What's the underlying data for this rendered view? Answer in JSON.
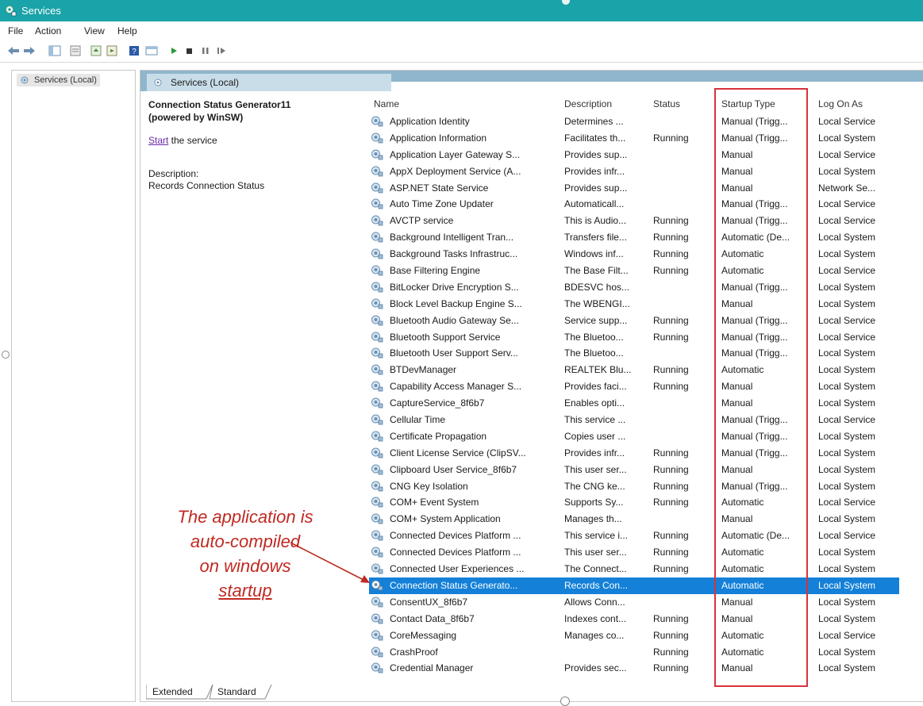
{
  "window": {
    "title": "Services"
  },
  "menu": [
    "File",
    "Action",
    "View",
    "Help"
  ],
  "tree": {
    "root_label": "Services (Local)"
  },
  "panel": {
    "header": "Services (Local)"
  },
  "detail": {
    "name_line1": "Connection Status Generator11",
    "name_line2": "(powered by WinSW)",
    "start_link": "Start",
    "start_rest": " the service",
    "desc_label": "Description:",
    "desc_text": "Records Connection Status"
  },
  "columns": {
    "name": "Name",
    "description": "Description",
    "status": "Status",
    "startup": "Startup Type",
    "logon": "Log On As"
  },
  "rows": [
    {
      "name": "Application Identity",
      "description": "Determines ...",
      "status": "",
      "startup": "Manual (Trigg...",
      "logon": "Local Service"
    },
    {
      "name": "Application Information",
      "description": "Facilitates th...",
      "status": "Running",
      "startup": "Manual (Trigg...",
      "logon": "Local System"
    },
    {
      "name": "Application Layer Gateway S...",
      "description": "Provides sup...",
      "status": "",
      "startup": "Manual",
      "logon": "Local Service"
    },
    {
      "name": "AppX Deployment Service (A...",
      "description": "Provides infr...",
      "status": "",
      "startup": "Manual",
      "logon": "Local System"
    },
    {
      "name": "ASP.NET State Service",
      "description": "Provides sup...",
      "status": "",
      "startup": "Manual",
      "logon": "Network Se..."
    },
    {
      "name": "Auto Time Zone Updater",
      "description": "Automaticall...",
      "status": "",
      "startup": "Manual (Trigg...",
      "logon": "Local Service"
    },
    {
      "name": "AVCTP service",
      "description": "This is Audio...",
      "status": "Running",
      "startup": "Manual (Trigg...",
      "logon": "Local Service"
    },
    {
      "name": "Background Intelligent Tran...",
      "description": "Transfers file...",
      "status": "Running",
      "startup": "Automatic (De...",
      "logon": "Local System"
    },
    {
      "name": "Background Tasks Infrastruc...",
      "description": "Windows inf...",
      "status": "Running",
      "startup": "Automatic",
      "logon": "Local System"
    },
    {
      "name": "Base Filtering Engine",
      "description": "The Base Filt...",
      "status": "Running",
      "startup": "Automatic",
      "logon": "Local Service"
    },
    {
      "name": "BitLocker Drive Encryption S...",
      "description": "BDESVC hos...",
      "status": "",
      "startup": "Manual (Trigg...",
      "logon": "Local System"
    },
    {
      "name": "Block Level Backup Engine S...",
      "description": "The WBENGI...",
      "status": "",
      "startup": "Manual",
      "logon": "Local System"
    },
    {
      "name": "Bluetooth Audio Gateway Se...",
      "description": "Service supp...",
      "status": "Running",
      "startup": "Manual (Trigg...",
      "logon": "Local Service"
    },
    {
      "name": "Bluetooth Support Service",
      "description": "The Bluetoo...",
      "status": "Running",
      "startup": "Manual (Trigg...",
      "logon": "Local Service"
    },
    {
      "name": "Bluetooth User Support Serv...",
      "description": "The Bluetoo...",
      "status": "",
      "startup": "Manual (Trigg...",
      "logon": "Local System"
    },
    {
      "name": "BTDevManager",
      "description": "REALTEK Blu...",
      "status": "Running",
      "startup": "Automatic",
      "logon": "Local System"
    },
    {
      "name": "Capability Access Manager S...",
      "description": "Provides faci...",
      "status": "Running",
      "startup": "Manual",
      "logon": "Local System"
    },
    {
      "name": "CaptureService_8f6b7",
      "description": "Enables opti...",
      "status": "",
      "startup": "Manual",
      "logon": "Local System"
    },
    {
      "name": "Cellular Time",
      "description": "This service ...",
      "status": "",
      "startup": "Manual (Trigg...",
      "logon": "Local Service"
    },
    {
      "name": "Certificate Propagation",
      "description": "Copies user ...",
      "status": "",
      "startup": "Manual (Trigg...",
      "logon": "Local System"
    },
    {
      "name": "Client License Service (ClipSV...",
      "description": "Provides infr...",
      "status": "Running",
      "startup": "Manual (Trigg...",
      "logon": "Local System"
    },
    {
      "name": "Clipboard User Service_8f6b7",
      "description": "This user ser...",
      "status": "Running",
      "startup": "Manual",
      "logon": "Local System"
    },
    {
      "name": "CNG Key Isolation",
      "description": "The CNG ke...",
      "status": "Running",
      "startup": "Manual (Trigg...",
      "logon": "Local System"
    },
    {
      "name": "COM+ Event System",
      "description": "Supports Sy...",
      "status": "Running",
      "startup": "Automatic",
      "logon": "Local Service"
    },
    {
      "name": "COM+ System Application",
      "description": "Manages th...",
      "status": "",
      "startup": "Manual",
      "logon": "Local System"
    },
    {
      "name": "Connected Devices Platform ...",
      "description": "This service i...",
      "status": "Running",
      "startup": "Automatic (De...",
      "logon": "Local Service"
    },
    {
      "name": "Connected Devices Platform ...",
      "description": "This user ser...",
      "status": "Running",
      "startup": "Automatic",
      "logon": "Local System"
    },
    {
      "name": "Connected User Experiences ...",
      "description": "The Connect...",
      "status": "Running",
      "startup": "Automatic",
      "logon": "Local System"
    },
    {
      "name": "Connection Status Generato...",
      "description": "Records Con...",
      "status": "",
      "startup": "Automatic",
      "logon": "Local System",
      "selected": true
    },
    {
      "name": "ConsentUX_8f6b7",
      "description": "Allows Conn...",
      "status": "",
      "startup": "Manual",
      "logon": "Local System"
    },
    {
      "name": "Contact Data_8f6b7",
      "description": "Indexes cont...",
      "status": "Running",
      "startup": "Manual",
      "logon": "Local System"
    },
    {
      "name": "CoreMessaging",
      "description": "Manages co...",
      "status": "Running",
      "startup": "Automatic",
      "logon": "Local Service"
    },
    {
      "name": "CrashProof",
      "description": "",
      "status": "Running",
      "startup": "Automatic",
      "logon": "Local System"
    },
    {
      "name": "Credential Manager",
      "description": "Provides sec...",
      "status": "Running",
      "startup": "Manual",
      "logon": "Local System"
    }
  ],
  "annotation": {
    "line1": "The application is",
    "line2": "auto-compiled",
    "line3": "on windows",
    "line4": "startup",
    "color": "#c02a22"
  },
  "tabs": {
    "extended": "Extended",
    "standard": "Standard"
  },
  "colors": {
    "titlebar": "#1aa3a8",
    "selection": "#1480d8",
    "highlight_box": "#d8323c"
  }
}
